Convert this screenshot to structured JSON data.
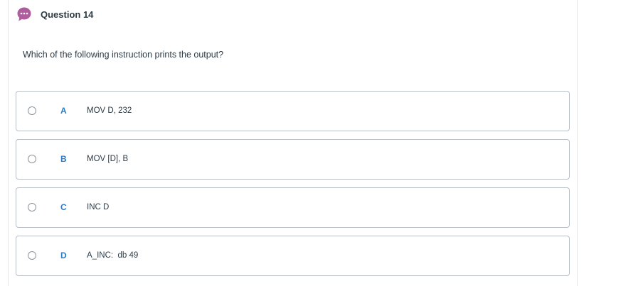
{
  "question": {
    "title": "Question 14",
    "prompt": "Which of the following instruction prints the output?",
    "icon": "chat-bubble-icon",
    "icon_color": "#b05d9e"
  },
  "options": [
    {
      "letter": "A",
      "text": "MOV D, 232"
    },
    {
      "letter": "B",
      "text": "MOV [D], B"
    },
    {
      "letter": "C",
      "text": "INC D"
    },
    {
      "letter": "D",
      "text": "A_INC:  db 49"
    }
  ],
  "colors": {
    "letter": "#2d7bc4",
    "border": "#b8bec4",
    "text": "#2d3b45"
  }
}
